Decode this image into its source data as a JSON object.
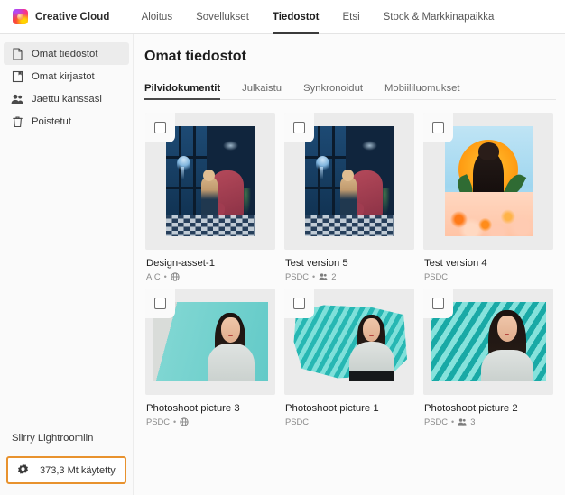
{
  "topnav": {
    "brand": "Creative Cloud",
    "links": [
      {
        "label": "Aloitus",
        "active": false
      },
      {
        "label": "Sovellukset",
        "active": false
      },
      {
        "label": "Tiedostot",
        "active": true
      },
      {
        "label": "Etsi",
        "active": false
      },
      {
        "label": "Stock & Markkinapaikka",
        "active": false
      }
    ]
  },
  "sidebar": {
    "items": [
      {
        "label": "Omat tiedostot",
        "icon": "document-icon",
        "active": true
      },
      {
        "label": "Omat kirjastot",
        "icon": "library-icon",
        "active": false
      },
      {
        "label": "Jaettu kanssasi",
        "icon": "people-icon",
        "active": false
      },
      {
        "label": "Poistetut",
        "icon": "trash-icon",
        "active": false
      }
    ],
    "lightroom_link": "Siirry Lightroomiin",
    "storage": {
      "label": "373,3 Mt käytetty",
      "icon": "gear-icon",
      "highlight_color": "#e8922e"
    }
  },
  "main": {
    "title": "Omat tiedostot",
    "tabs": [
      {
        "label": "Pilvidokumentit",
        "active": true
      },
      {
        "label": "Julkaistu",
        "active": false
      },
      {
        "label": "Synkronoidut",
        "active": false
      },
      {
        "label": "Mobiililuomukset",
        "active": false
      }
    ],
    "cards": [
      {
        "name": "Design-asset-1",
        "format": "AIC",
        "shared_icon": "globe-icon",
        "share_count": "",
        "art": "dark",
        "orientation": "portrait"
      },
      {
        "name": "Test version 5",
        "format": "PSDC",
        "shared_icon": "people-icon",
        "share_count": "2",
        "art": "dark",
        "orientation": "portrait"
      },
      {
        "name": "Test version 4",
        "format": "PSDC",
        "shared_icon": "",
        "share_count": "",
        "art": "sun",
        "orientation": "portrait"
      },
      {
        "name": "Photoshoot picture 3",
        "format": "PSDC",
        "shared_icon": "globe-icon",
        "share_count": "",
        "art": "photo1",
        "orientation": "landscape"
      },
      {
        "name": "Photoshoot picture 1",
        "format": "PSDC",
        "shared_icon": "",
        "share_count": "",
        "art": "photo2",
        "orientation": "landscape"
      },
      {
        "name": "Photoshoot picture 2",
        "format": "PSDC",
        "shared_icon": "people-icon",
        "share_count": "3",
        "art": "photo3",
        "orientation": "landscape"
      }
    ]
  }
}
